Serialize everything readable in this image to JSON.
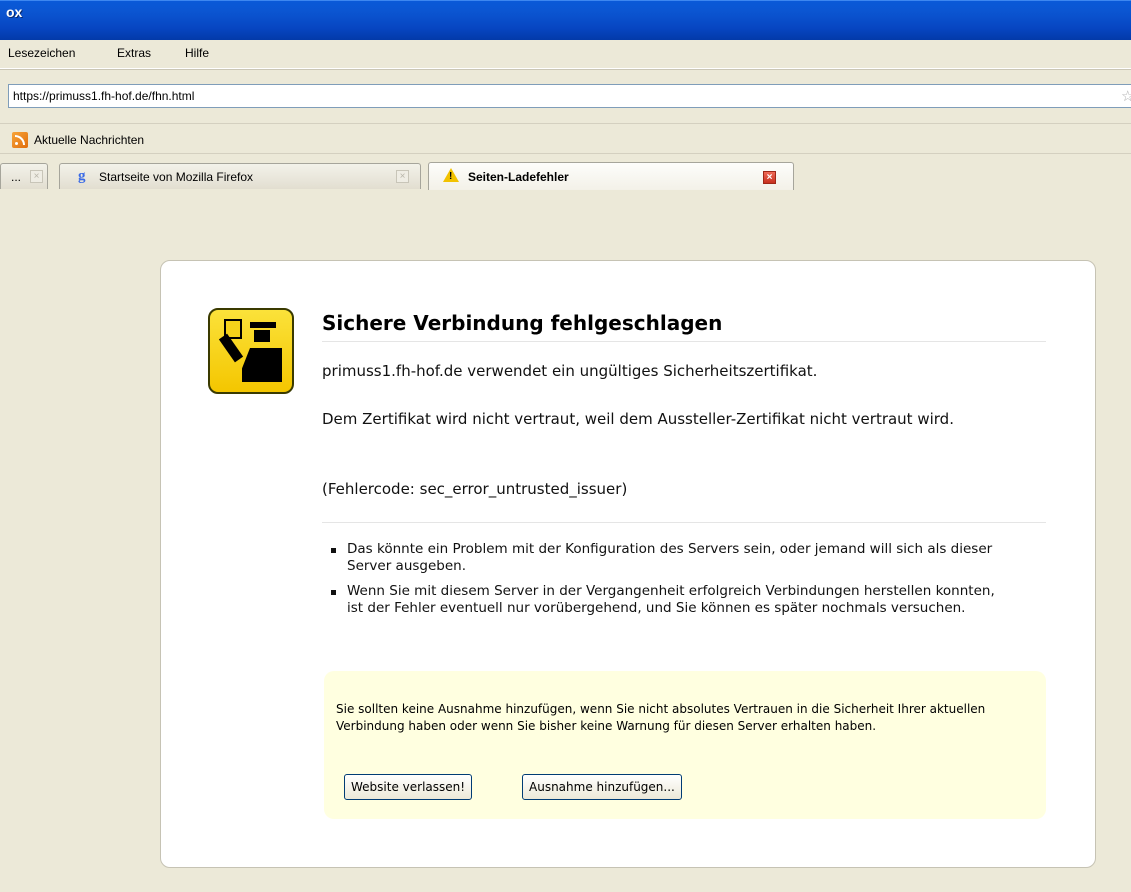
{
  "window": {
    "title": "ox"
  },
  "menu": [
    {
      "label": "Lesezeichen"
    },
    {
      "label": "Extras"
    },
    {
      "label": "Hilfe"
    }
  ],
  "urlbar": {
    "value": "https://primuss1.fh-hof.de/fhn.html",
    "star": "☆"
  },
  "bookmarks": [
    {
      "label": "Aktuelle Nachrichten",
      "icon": "rss-icon"
    }
  ],
  "tabs": [
    {
      "label": "...",
      "icon": "",
      "active": false
    },
    {
      "label": "Startseite von Mozilla Firefox",
      "icon": "google-icon",
      "active": false
    },
    {
      "label": "Seiten-Ladefehler",
      "icon": "warning-icon",
      "active": true
    }
  ],
  "error": {
    "title": "Sichere Verbindung fehlgeschlagen",
    "line1": "primuss1.fh-hof.de verwendet ein ungültiges Sicherheitszertifikat.",
    "line2": "Dem Zertifikat wird nicht vertraut, weil dem Aussteller-Zertifikat nicht vertraut wird.",
    "code": "(Fehlercode: sec_error_untrusted_issuer)",
    "bullets": [
      "Das könnte ein Problem mit der Konfiguration des Servers sein, oder jemand will sich als dieser Server ausgeben.",
      "Wenn Sie mit diesem Server in der Vergangenheit erfolgreich Verbindungen herstellen konnten, ist der Fehler eventuell nur vorübergehend, und Sie können es später nochmals versuchen."
    ],
    "warning": "Sie sollten keine Ausnahme hinzufügen, wenn Sie nicht absolutes Vertrauen in die Sicherheit Ihrer aktuellen Verbindung haben oder wenn Sie bisher keine Warnung für diesen Server erhalten haben.",
    "leave_button": "Website verlassen!",
    "exception_button": "Ausnahme hinzufügen..."
  }
}
